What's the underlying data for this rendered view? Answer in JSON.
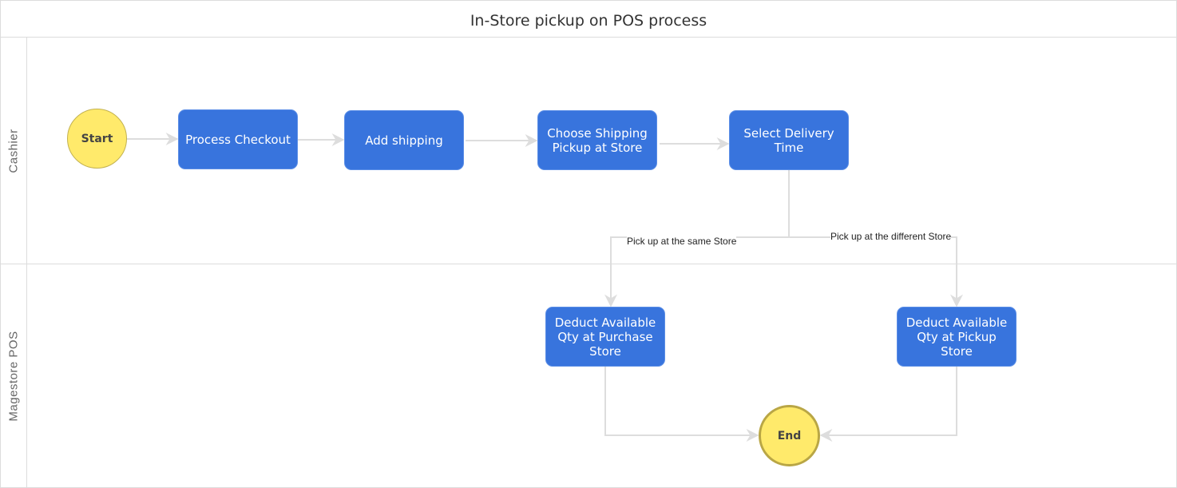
{
  "diagram": {
    "title": "In-Store pickup on POS process",
    "lanes": [
      {
        "label": "Cashier"
      },
      {
        "label": "Magestore POS"
      }
    ],
    "nodes": {
      "start": {
        "label": "Start",
        "type": "start-event"
      },
      "process_checkout": {
        "label": "Process Checkout",
        "type": "task"
      },
      "add_shipping": {
        "label": "Add shipping",
        "type": "task"
      },
      "choose_shipping": {
        "label": "Choose Shipping Pickup at Store",
        "type": "task"
      },
      "select_delivery": {
        "label": "Select Delivery Time",
        "type": "task"
      },
      "deduct_purchase": {
        "label": "Deduct Available Qty at Purchase Store",
        "type": "task"
      },
      "deduct_pickup": {
        "label": "Deduct Available Qty at Pickup Store",
        "type": "task"
      },
      "end": {
        "label": "End",
        "type": "end-event"
      }
    },
    "edges": [
      {
        "from": "start",
        "to": "process_checkout",
        "label": ""
      },
      {
        "from": "process_checkout",
        "to": "add_shipping",
        "label": ""
      },
      {
        "from": "add_shipping",
        "to": "choose_shipping",
        "label": ""
      },
      {
        "from": "choose_shipping",
        "to": "select_delivery",
        "label": ""
      },
      {
        "from": "select_delivery",
        "to": "deduct_purchase",
        "label": "Pick up at the same Store"
      },
      {
        "from": "select_delivery",
        "to": "deduct_pickup",
        "label": "Pick up at the different Store"
      },
      {
        "from": "deduct_purchase",
        "to": "end",
        "label": ""
      },
      {
        "from": "deduct_pickup",
        "to": "end",
        "label": ""
      }
    ],
    "colors": {
      "task_fill": "#3874dd",
      "event_fill": "#ffea6b",
      "connector": "#dddddd"
    }
  }
}
